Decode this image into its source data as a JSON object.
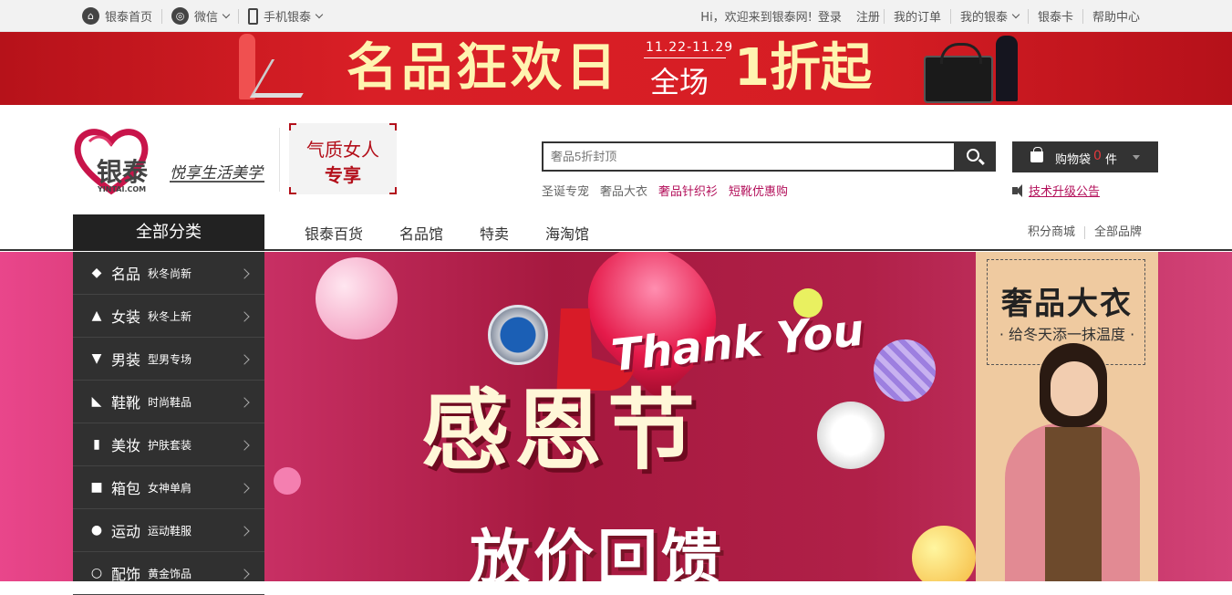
{
  "topbar": {
    "home": "银泰首页",
    "wechat": "微信",
    "mobile": "手机银泰",
    "welcome": "Hi，欢迎来到银泰网!",
    "login": "登录",
    "register": "注册",
    "orders": "我的订单",
    "my_yintai": "我的银泰",
    "card": "银泰卡",
    "help": "帮助中心"
  },
  "banner": {
    "title": "名品狂欢日",
    "date": "11.22-11.29",
    "all": "全场",
    "discount": "1折起"
  },
  "header": {
    "logo_cn": "银泰",
    "logo_en": "YINTAI.COM",
    "slogan": "悦享生活美学",
    "promo_line1": "气质女人",
    "promo_line2": "专享",
    "search_placeholder": "奢品5折封顶",
    "hotwords": [
      "圣诞专宠",
      "奢品大衣",
      "奢品针织衫",
      "短靴优惠购"
    ],
    "cart_label": "购物袋",
    "cart_count": "0",
    "cart_unit": "件",
    "notice": "技术升级公告"
  },
  "nav": {
    "category_head": "全部分类",
    "items": [
      "银泰百货",
      "名品馆",
      "特卖",
      "海淘馆"
    ],
    "right": [
      "积分商城",
      "全部品牌"
    ]
  },
  "categories": [
    {
      "icon": "diamond-icon",
      "name": "名品",
      "sub": "秋冬尚新"
    },
    {
      "icon": "dress-icon",
      "name": "女装",
      "sub": "秋冬上新"
    },
    {
      "icon": "suit-icon",
      "name": "男装",
      "sub": "型男专场"
    },
    {
      "icon": "heel-icon",
      "name": "鞋靴",
      "sub": "时尚鞋品"
    },
    {
      "icon": "cosmetics-icon",
      "name": "美妆",
      "sub": "护肤套装"
    },
    {
      "icon": "bag-icon",
      "name": "箱包",
      "sub": "女神单肩"
    },
    {
      "icon": "ball-icon",
      "name": "运动",
      "sub": "运动鞋服"
    },
    {
      "icon": "ring-icon",
      "name": "配饰",
      "sub": "黄金饰品"
    }
  ],
  "hero": {
    "thank_you": "Thank You",
    "title": "感恩节",
    "subtitle": "放价回馈"
  },
  "side_ad": {
    "title": "奢品大衣",
    "subtitle": "· 给冬天添一抹温度 ·"
  },
  "colors": {
    "accent_red": "#b30f1a",
    "link_magenta": "#b30f5a",
    "dark": "#333333"
  }
}
